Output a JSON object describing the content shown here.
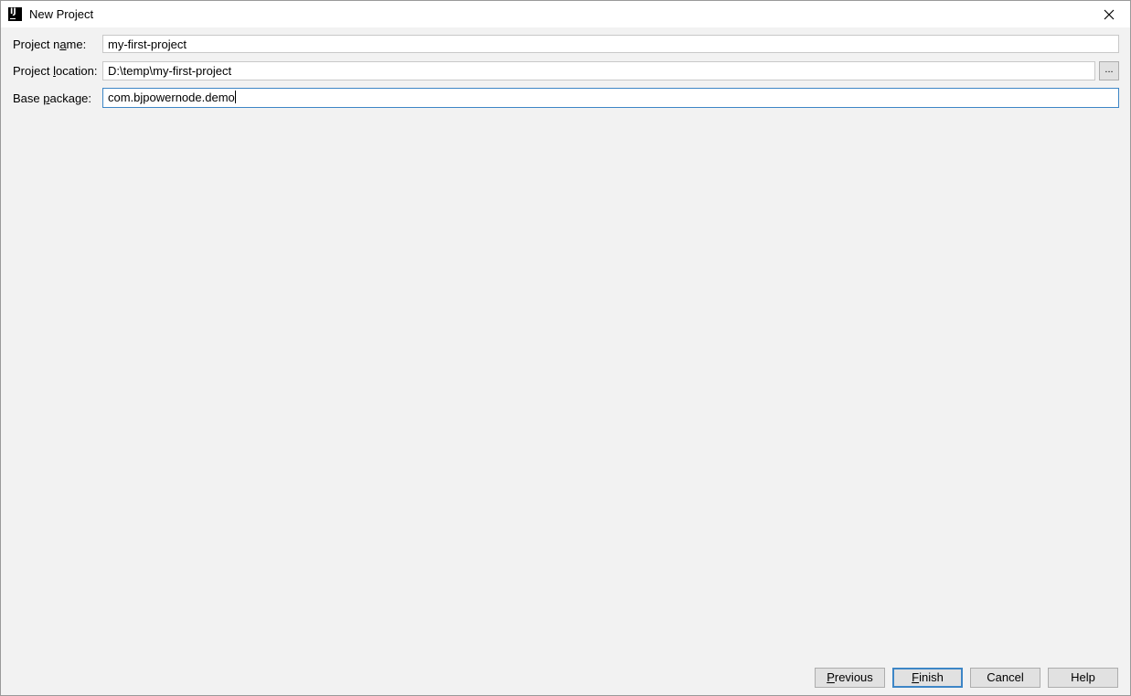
{
  "window": {
    "title": "New Project",
    "app_icon_text": "IJ"
  },
  "form": {
    "project_name_label_pre": "Project n",
    "project_name_label_mnemonic": "a",
    "project_name_label_post": "me:",
    "project_name_value": "my-first-project",
    "project_location_label_pre": "Project ",
    "project_location_label_mnemonic": "l",
    "project_location_label_post": "ocation:",
    "project_location_value": "D:\\temp\\my-first-project",
    "browse_label": "...",
    "base_package_label_pre": "Base ",
    "base_package_label_mnemonic": "p",
    "base_package_label_post": "ackage:",
    "base_package_value": "com.bjpowernode.demo"
  },
  "footer": {
    "previous_mnemonic": "P",
    "previous_rest": "revious",
    "finish_mnemonic": "F",
    "finish_rest": "inish",
    "cancel_label": "Cancel",
    "help_label": "Help"
  }
}
